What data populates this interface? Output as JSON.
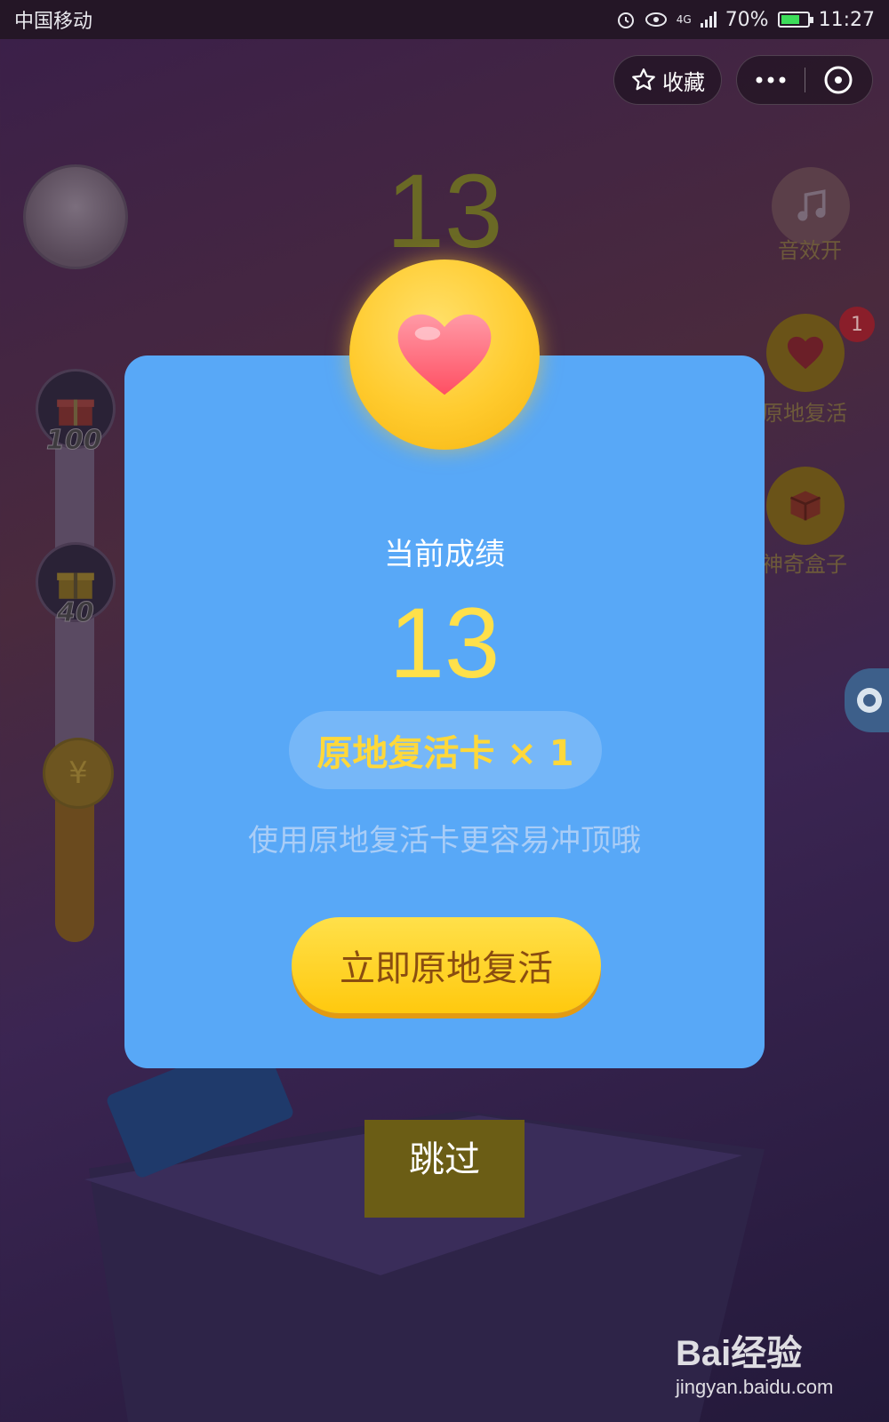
{
  "status_bar": {
    "carrier": "中国移动",
    "network": "4G",
    "battery_percent": "70%",
    "battery_level": 0.7,
    "time": "11:27"
  },
  "capsule": {
    "favorite_label": "收藏",
    "more_icon": "more-dots-icon",
    "close_icon": "close-circle-icon"
  },
  "game": {
    "background_score": "13",
    "side_buttons": [
      {
        "label": "音效开",
        "icon": "music-note-icon"
      },
      {
        "label": "原地复活",
        "icon": "heart-icon",
        "badge": "1"
      },
      {
        "label": "神奇盒子",
        "icon": "box-icon"
      }
    ],
    "milestones": [
      "100",
      "40"
    ],
    "coin_symbol": "¥"
  },
  "dialog": {
    "title": "当前成绩",
    "score": "13",
    "card_text": "原地复活卡 × 1",
    "hint": "使用原地复活卡更容易冲顶哦",
    "revive_button": "立即原地复活",
    "skip_label": "跳过"
  },
  "watermark": {
    "logo": "Bai经验",
    "url": "jingyan.baidu.com"
  },
  "colors": {
    "dialog_bg": "#58a8f7",
    "accent_yellow": "#ffd83a",
    "button_text": "#8a4d10"
  }
}
